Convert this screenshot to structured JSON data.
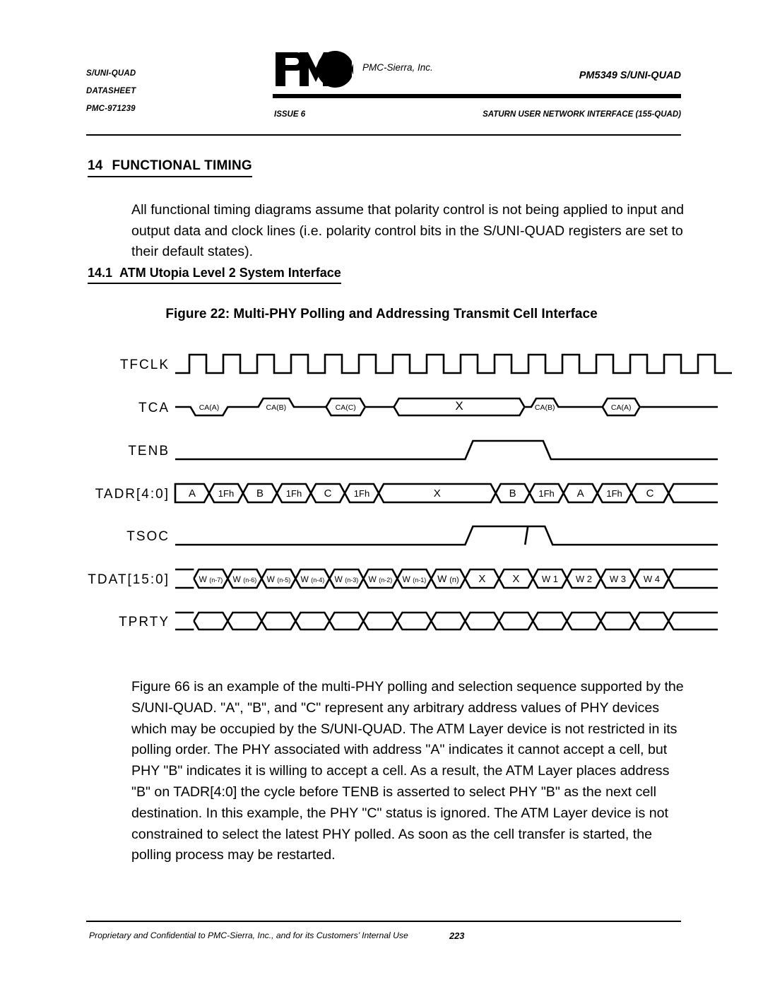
{
  "header": {
    "left_lines": [
      "S/UNI-QUAD",
      "DATASHEET",
      "PMC-971239"
    ],
    "logo_text": "PMC",
    "logo_caption": "PMC-Sierra, Inc.",
    "part_number": "PM5349 S/UNI-QUAD",
    "issue": "ISSUE 6",
    "product_name": "SATURN USER NETWORK INTERFACE (155-QUAD)"
  },
  "section": {
    "number": "14",
    "title": "FUNCTIONAL TIMING",
    "intro": "All functional timing diagrams assume that polarity control is not being applied to input and output data and clock lines (i.e. polarity control bits in the S/UNI-QUAD registers are set to their default states).",
    "subsection_number": "14.1",
    "subsection_title": "ATM Utopia Level 2 System Interface",
    "figure_caption": "Figure 22:  Multi-PHY Polling and Addressing Transmit Cell Interface",
    "body": "Figure 66 is an example of  the multi-PHY polling and selection sequence supported by the S/UNI-QUAD. \"A\", \"B\", and \"C\" represent any arbitrary address values of PHY devices which may be occupied by the S/UNI-QUAD. The ATM Layer device is not restricted in its polling order. The PHY associated with address \"A\" indicates it cannot accept a cell, but PHY \"B\" indicates it is willing to accept a cell.  As a result, the ATM Layer places address \"B\" on TADR[4:0] the cycle before TENB is asserted to select PHY \"B\" as the next cell destination.  In this example, the PHY \"C\" status is ignored.  The ATM Layer device is not constrained to select the latest PHY polled.  As soon as the cell transfer is started, the polling process may be restarted."
  },
  "timing": {
    "cycles": 16,
    "signals": [
      {
        "name": "TFCLK",
        "type": "clock"
      },
      {
        "name": "TCA",
        "type": "level",
        "labels": [
          "CA(A)",
          "CA(B)",
          "CA(C)",
          "X",
          "CA(B)",
          "CA(A)"
        ]
      },
      {
        "name": "TENB",
        "type": "pulse"
      },
      {
        "name": "TADR[4:0]",
        "type": "bus",
        "cells": [
          "A",
          "1Fh",
          "B",
          "1Fh",
          "C",
          "1Fh",
          "X",
          "B",
          "1Fh",
          "A",
          "1Fh",
          "C"
        ]
      },
      {
        "name": "TSOC",
        "type": "pulse"
      },
      {
        "name": "TDAT[15:0]",
        "type": "bus",
        "cells": [
          "W (n-7)",
          "W (n-6)",
          "W (n-5)",
          "W (n-4)",
          "W (n-3)",
          "W (n-2)",
          "W (n-1)",
          "W (n)",
          "X",
          "X",
          "W 1",
          "W 2",
          "W 3",
          "W 4"
        ]
      },
      {
        "name": "TPRTY",
        "type": "bus",
        "cells": [
          "",
          "",
          "",
          "",
          "",
          "",
          "",
          "",
          "",
          "",
          "",
          "",
          "",
          ""
        ]
      }
    ]
  },
  "footer": {
    "notice": "Proprietary and Confidential to PMC-Sierra, Inc., and for its Customers’ Internal Use",
    "page": "223"
  }
}
